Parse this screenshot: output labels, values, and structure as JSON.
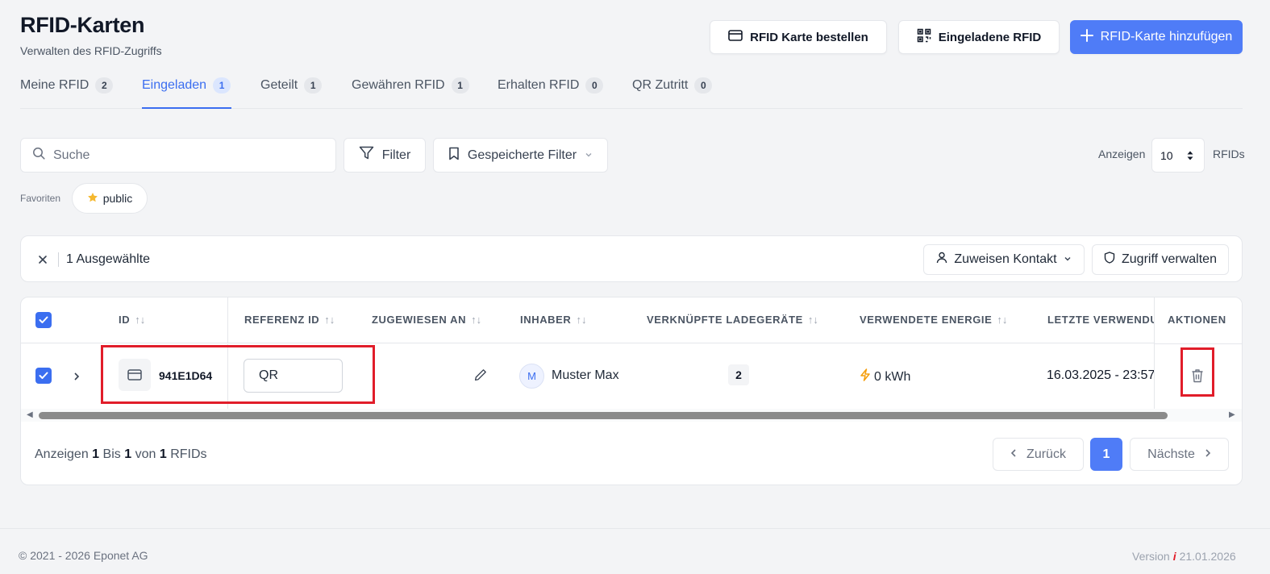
{
  "page": {
    "title": "RFID-Karten",
    "subtitle": "Verwalten des RFID-Zugriffs"
  },
  "header_buttons": {
    "order": "RFID Karte bestellen",
    "invited": "Eingeladene RFID",
    "add": "RFID-Karte hinzufügen"
  },
  "tabs": [
    {
      "label": "Meine RFID",
      "count": "2"
    },
    {
      "label": "Eingeladen",
      "count": "1"
    },
    {
      "label": "Geteilt",
      "count": "1"
    },
    {
      "label": "Gewähren RFID",
      "count": "1"
    },
    {
      "label": "Erhalten RFID",
      "count": "0"
    },
    {
      "label": "QR Zutritt",
      "count": "0"
    }
  ],
  "search": {
    "placeholder": "Suche"
  },
  "filter": {
    "label": "Filter",
    "saved_label": "Gespeicherte Filter"
  },
  "pagesize": {
    "prefix": "Anzeigen",
    "value": "10",
    "suffix": "RFIDs"
  },
  "favorites": {
    "label": "Favoriten",
    "chip": "public"
  },
  "selection": {
    "text": "1 Ausgewählte",
    "assign_contact": "Zuweisen Kontakt",
    "manage_access": "Zugriff verwalten"
  },
  "table": {
    "columns": [
      "ID",
      "REFERENZ ID",
      "ZUGEWIESEN AN",
      "INHABER",
      "VERKNÜPFTE LADEGERÄTE",
      "VERWENDETE ENERGIE",
      "LETZTE VERWENDUNG",
      "AKTIONEN"
    ],
    "rows": [
      {
        "id": "941E1D64",
        "reference_id": "QR",
        "owner_initial": "M",
        "owner": "Muster Max",
        "chargers": "2",
        "energy": "0 kWh",
        "last_used": "16.03.2025 - 23:57"
      }
    ]
  },
  "pagination": {
    "show": "Anzeigen",
    "from": "1",
    "to_word": "Bis",
    "to": "1",
    "of_word": "von",
    "total": "1",
    "unit": "RFIDs",
    "prev": "Zurück",
    "current": "1",
    "next": "Nächste"
  },
  "footer": {
    "copyright": "© 2021 - 2026 Eponet AG",
    "version_label": "Version",
    "version_info": "i",
    "version": "21.01.2026"
  },
  "colors": {
    "primary": "#4f7cf7",
    "active_tab": "#3b6ef0",
    "highlight": "#e11d2a",
    "energy_icon": "#f59e0b",
    "star": "#f5b82e"
  }
}
